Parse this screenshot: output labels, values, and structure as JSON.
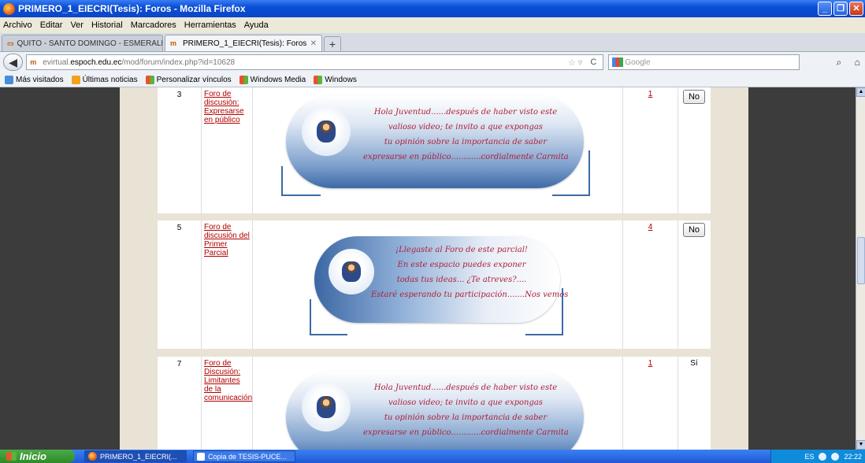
{
  "window": {
    "title": "PRIMERO_1_EIECRI(Tesis): Foros - Mozilla Firefox"
  },
  "menu": [
    "Archivo",
    "Editar",
    "Ver",
    "Historial",
    "Marcadores",
    "Herramientas",
    "Ayuda"
  ],
  "tabs": [
    {
      "label": "QUITO - SANTO DOMINGO - ESMERALDA..."
    },
    {
      "label": "PRIMERO_1_EIECRI(Tesis): Foros"
    }
  ],
  "address": {
    "prefix": "evirtual.",
    "domain": "espoch.edu.ec",
    "path": "/mod/forum/index.php?id=10628"
  },
  "search": {
    "placeholder": "Google"
  },
  "bookmarks": [
    "Más visitados",
    "Últimas noticias",
    "Personalizar vínculos",
    "Windows Media",
    "Windows"
  ],
  "forums": [
    {
      "num": "3",
      "title": "Foro de discusión: Expresarse en público",
      "count": "1",
      "notify": "No",
      "message": [
        "Hola Juventud......después de haber visto este",
        "valioso video; te invito a que expongas",
        "tu opinión sobre la importancia de saber",
        "expresarse en público............cordialmente Carmita"
      ]
    },
    {
      "num": "5",
      "title": "Foro de discusión del Primer Parcial",
      "count": "4",
      "notify": "No",
      "message": [
        "¡Llegaste al Foro de este parcial!",
        "En este espacio puedes exponer",
        "todas tus ideas... ¿Te atreves?....",
        "Estaré esperando tu participación.......Nos vemos"
      ]
    },
    {
      "num": "7",
      "title": "Foro de Discusión: Limitantes de la comunicación",
      "count": "1",
      "notify": "Sí",
      "message": [
        "Hola Juventud......después de haber visto este",
        "valioso video; te invito a que expongas",
        "tu opinión sobre la importancia de saber",
        "expresarse en público............cordialmente Carmita"
      ]
    }
  ],
  "taskbar": {
    "start": "Inicio",
    "items": [
      "PRIMERO_1_EIECRI(...",
      "Copia de TESIS-PUCE..."
    ],
    "lang": "ES",
    "clock": "22:22"
  }
}
